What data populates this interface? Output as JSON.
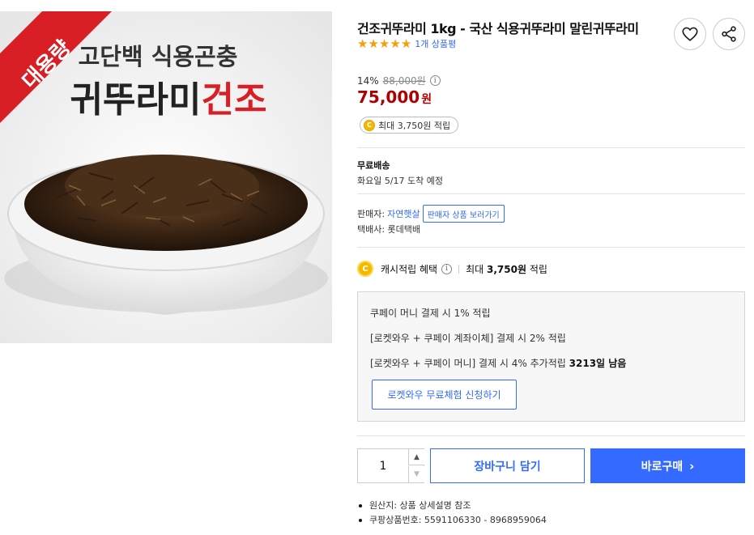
{
  "colors": {
    "accent": "#346aff",
    "price": "#ae0000",
    "star": "#f59e0b",
    "coin": "#f5b800",
    "banner_red": "#d81f26"
  },
  "image": {
    "banner": "대용량",
    "line1": "고단백 식용곤충",
    "line2_black": "귀뚜라미",
    "line2_red": "건조"
  },
  "product": {
    "title": "건조귀뚜라미 1kg - 국산 식용귀뚜라미 말린귀뚜라미",
    "rating": 5,
    "review_count": "1개 상품평"
  },
  "actions": {
    "wishlist_icon": "heart-icon",
    "share_icon": "share-icon"
  },
  "price": {
    "discount_rate": "14%",
    "original": "88,000원",
    "sale": "75,000",
    "sale_unit": "원",
    "cash_chip": "최대 3,750원 적립"
  },
  "shipping": {
    "label": "무료배송",
    "arrival": "화요일 5/17 도착 예정"
  },
  "seller": {
    "label": "판매자:",
    "name": "자연햇살",
    "button": "판매자 상품 보러가기",
    "courier": "택배사: 롯데택배"
  },
  "cash_benefit": {
    "label": "캐시적립 혜택",
    "prefix": "최대",
    "amount": "3,750원",
    "suffix": "적립"
  },
  "benefit_box": {
    "line1": "쿠페이 머니 결제 시 1% 적립",
    "line2": "[로켓와우 + 쿠페이 계좌이체] 결제 시 2% 적립",
    "line3": "[로켓와우 + 쿠페이 머니] 결제 시 4% 추가적립",
    "line3_bold": "3213일 남음",
    "trial_button": "로켓와우 무료체험 신청하기"
  },
  "purchase": {
    "quantity": "1",
    "cart_button": "장바구니 담기",
    "buy_button": "바로구매"
  },
  "notes": [
    "원산지: 상품 상세설명 참조",
    "쿠팡상품번호: 5591106330 - 8968959064"
  ]
}
